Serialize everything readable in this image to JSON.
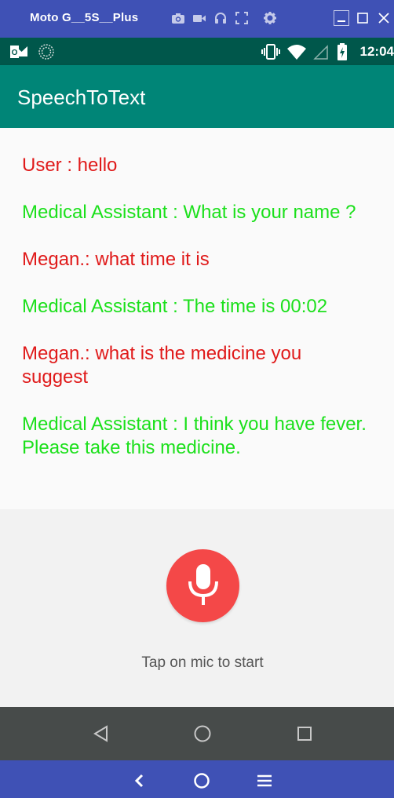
{
  "emulator": {
    "device_title": "Moto G__5S__Plus",
    "tool_icons": [
      "camera-icon",
      "video-icon",
      "headset-icon",
      "fullscreen-icon",
      "gear-icon"
    ],
    "window_controls": [
      "minimize-icon",
      "maximize-icon",
      "close-icon"
    ],
    "bottom_controls": [
      "back-chevron-icon",
      "home-circle-icon",
      "menu-icon"
    ]
  },
  "status_bar": {
    "time": "12:04",
    "left_icons": [
      "outlook-icon",
      "sync-icon"
    ],
    "right_icons": [
      "vibrate-icon",
      "wifi-icon",
      "signal-icon",
      "battery-icon"
    ]
  },
  "app": {
    "title": "SpeechToText"
  },
  "messages": [
    {
      "role": "user",
      "text": "User : hello"
    },
    {
      "role": "bot",
      "text": "Medical Assistant : What is your name ?"
    },
    {
      "role": "user",
      "text": "Megan.: what time it is"
    },
    {
      "role": "bot",
      "text": "Medical Assistant : The time is 00:02"
    },
    {
      "role": "user",
      "text": "Megan.: what is the medicine you suggest"
    },
    {
      "role": "bot",
      "text": "Medical Assistant : I think you have fever. Please take this medicine."
    }
  ],
  "mic": {
    "icon": "microphone-icon",
    "hint": "Tap on mic to start"
  },
  "nav_bar": {
    "buttons": [
      "back-triangle-icon",
      "home-icon",
      "recents-icon"
    ]
  },
  "colors": {
    "user_text": "#e01a1a",
    "bot_text": "#1ce01c",
    "app_bar": "#008577",
    "status_bar": "#00574b",
    "mic_button": "#f44848",
    "emulator_frame": "#3f51b5"
  }
}
